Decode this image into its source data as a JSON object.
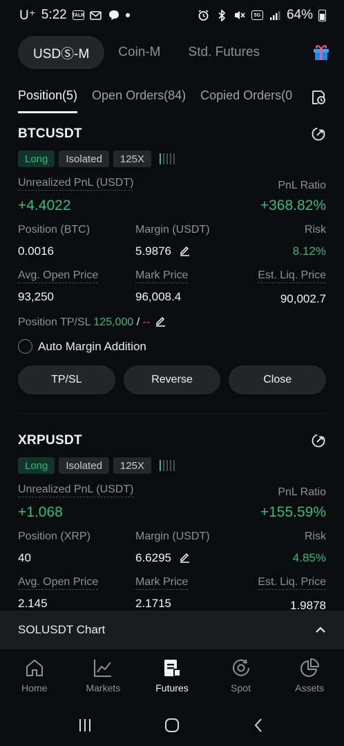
{
  "status_bar": {
    "carrier": "U⁺",
    "time": "5:22",
    "battery": "64%",
    "icons": [
      "talk-icon",
      "mail-icon",
      "chat-icon",
      "alarm-icon",
      "bluetooth-icon",
      "mute-icon",
      "5g-signal-icon",
      "signal-icon",
      "battery-icon"
    ],
    "talk_label": "TALK",
    "network_label": "5G"
  },
  "mode_tabs": {
    "items": [
      "USDⓈ-M",
      "Coin-M",
      "Std. Futures"
    ],
    "active": "USDⓈ-M"
  },
  "position_tabs": {
    "items": [
      "Position(5)",
      "Open Orders(84)",
      "Copied Orders(0"
    ],
    "active": "Position(5)"
  },
  "labels": {
    "unrealized_pnl": "Unrealized PnL (USDT)",
    "pnl_ratio": "PnL Ratio",
    "margin": "Margin (USDT)",
    "risk": "Risk",
    "avg_open": "Avg. Open Price",
    "mark_price": "Mark Price",
    "est_liq": "Est. Liq. Price",
    "tpsl_prefix": "Position TP/SL",
    "auto_margin": "Auto Margin Addition",
    "btn_tpsl": "TP/SL",
    "btn_reverse": "Reverse",
    "btn_close": "Close"
  },
  "positions": [
    {
      "symbol": "BTCUSDT",
      "side": "Long",
      "margin_mode": "Isolated",
      "leverage": "125X",
      "unrealized_pnl": "+4.4022",
      "pnl_ratio": "+368.82%",
      "position_label": "Position (BTC)",
      "position": "0.0016",
      "margin": "5.9876",
      "risk": "8.12%",
      "avg_open_price": "93,250",
      "mark_price": "96,008.4",
      "est_liq_price": "90,002.7",
      "tp": "125,000",
      "tpsl_sep": "/",
      "sl": "--"
    },
    {
      "symbol": "XRPUSDT",
      "side": "Long",
      "margin_mode": "Isolated",
      "leverage": "125X",
      "unrealized_pnl": "+1.068",
      "pnl_ratio": "+155.59%",
      "position_label": "Position (XRP)",
      "position": "40",
      "margin": "6.6295",
      "risk": "4.85%",
      "avg_open_price": "2.145",
      "mark_price": "2.1715",
      "est_liq_price": "1.9878"
    }
  ],
  "chart_bar": {
    "label": "SOLUSDT Chart"
  },
  "bottom_nav": {
    "items": [
      "Home",
      "Markets",
      "Futures",
      "Spot",
      "Assets"
    ],
    "active": "Futures"
  },
  "colors": {
    "green": "#2ebd85",
    "red": "#e5524c",
    "background": "#0b0c0e",
    "pill": "#24262a"
  }
}
